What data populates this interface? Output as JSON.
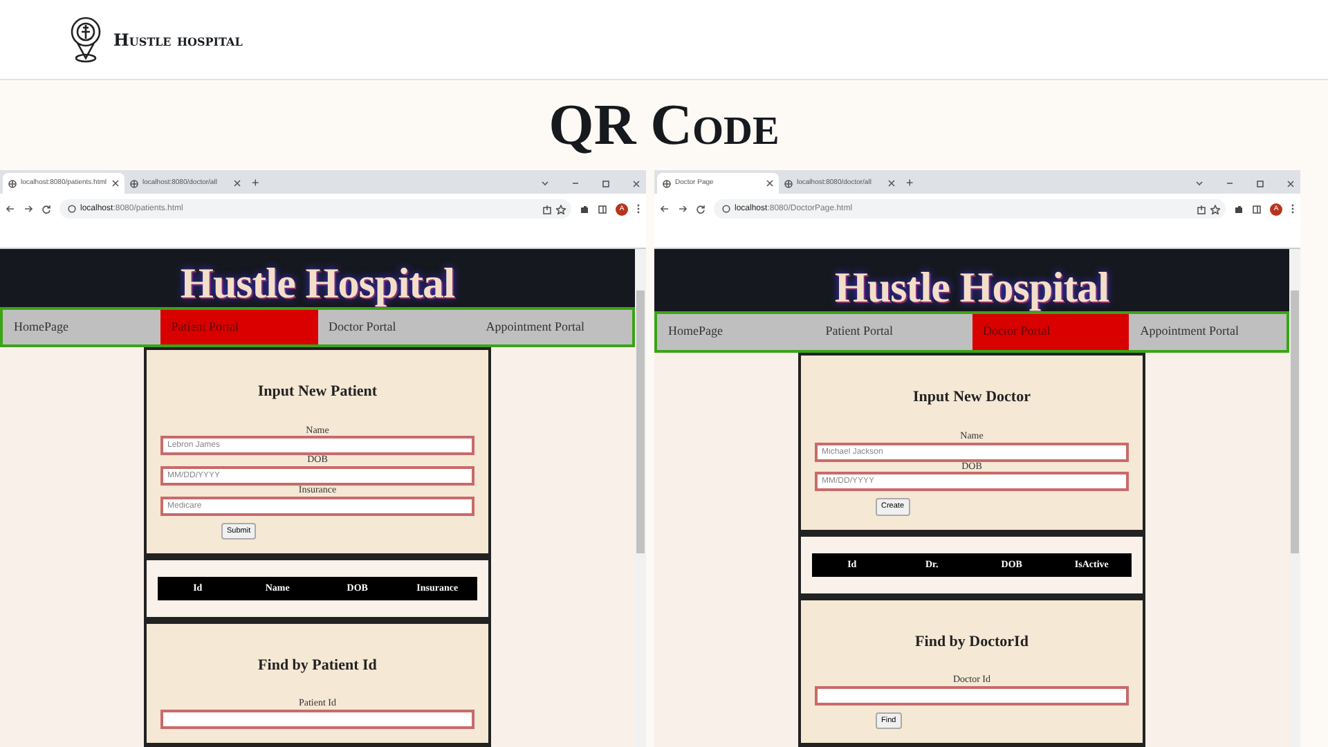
{
  "header": {
    "brand": "Hustle hospital"
  },
  "title": "QR Code",
  "browsers": [
    {
      "tabs": [
        {
          "label": "localhost:8080/patients.html",
          "selected": true
        },
        {
          "label": "localhost:8080/doctor/all",
          "selected": false
        }
      ],
      "new_tab": "+",
      "url_host": "localhost",
      "url_path": ":8080/patients.html",
      "profile": "A",
      "site_title": "Hustle Hospital",
      "nav": [
        {
          "label": "HomePage",
          "selected": false
        },
        {
          "label": "Patient Portal",
          "selected": true
        },
        {
          "label": "Doctor Portal",
          "selected": false
        },
        {
          "label": "Appointment Portal",
          "selected": false
        }
      ],
      "sections": [
        {
          "kind": "form",
          "heading": "Input New Patient",
          "fields": [
            {
              "label": "Name",
              "placeholder": "Lebron James"
            },
            {
              "label": "DOB",
              "placeholder": "MM/DD/YYYY"
            },
            {
              "label": "Insurance",
              "placeholder": "Medicare"
            }
          ],
          "button": "Submit"
        },
        {
          "kind": "table",
          "columns": [
            "Id",
            "Name",
            "DOB",
            "Insurance"
          ]
        },
        {
          "kind": "form",
          "heading": "Find by Patient Id",
          "fields": [
            {
              "label": "Patient Id"
            }
          ]
        }
      ]
    },
    {
      "tabs": [
        {
          "label": "Doctor Page",
          "selected": true
        },
        {
          "label": "localhost:8080/doctor/all",
          "selected": false
        }
      ],
      "new_tab": "+",
      "url_host": "localhost",
      "url_path": ":8080/DoctorPage.html",
      "profile": "A",
      "site_title": "Hustle Hospital",
      "nav": [
        {
          "label": "HomePage",
          "selected": false
        },
        {
          "label": "Patient Portal",
          "selected": false
        },
        {
          "label": "Doctor Portal",
          "selected": true
        },
        {
          "label": "Appointment Portal",
          "selected": false
        }
      ],
      "sections": [
        {
          "kind": "form",
          "heading": "Input New Doctor",
          "fields": [
            {
              "label": "Name",
              "placeholder": "Michael Jackson"
            },
            {
              "label": "DOB",
              "placeholder": "MM/DD/YYYY"
            }
          ],
          "button": "Create"
        },
        {
          "kind": "table",
          "columns": [
            "Id",
            "Dr.",
            "DOB",
            "IsActive"
          ]
        },
        {
          "kind": "form",
          "heading": "Find by DoctorId",
          "fields": [
            {
              "label": "Doctor Id"
            }
          ],
          "button": "Find"
        }
      ]
    }
  ]
}
